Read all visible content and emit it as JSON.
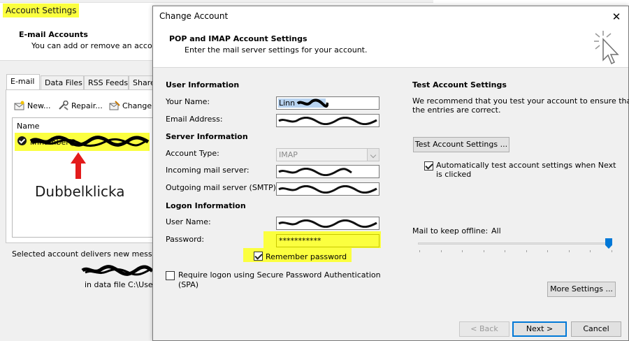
{
  "background_window": {
    "title": "Account Settings",
    "heading": "E-mail Accounts",
    "subheading": "You can add or remove an account",
    "tabs": [
      {
        "label": "E-mail",
        "active": true
      },
      {
        "label": "Data Files",
        "active": false
      },
      {
        "label": "RSS Feeds",
        "active": false
      },
      {
        "label": "Share",
        "active": false
      }
    ],
    "toolbar": {
      "new_label": "New...",
      "repair_label": "Repair...",
      "change_label": "Change..."
    },
    "list_header": "Name",
    "account_entry": "linnamber@",
    "annotation": "Dubbelklicka",
    "delivers_text": "Selected account delivers new messages",
    "data_file_text": "in data file C:\\Users"
  },
  "dialog": {
    "title": "Change Account",
    "heading": "POP and IMAP Account Settings",
    "subheading": "Enter the mail server settings for your account.",
    "sections": {
      "user_info": "User Information",
      "server_info": "Server Information",
      "logon_info": "Logon Information",
      "test_settings": "Test Account Settings"
    },
    "labels": {
      "your_name": "Your Name:",
      "email": "Email Address:",
      "account_type": "Account Type:",
      "incoming": "Incoming mail server:",
      "outgoing": "Outgoing mail server (SMTP):",
      "user_name": "User Name:",
      "password": "Password:"
    },
    "values": {
      "your_name": "Linn",
      "email": "",
      "account_type": "IMAP",
      "incoming": "",
      "outgoing": "",
      "user_name": "",
      "password": "***********"
    },
    "remember_password": {
      "label": "Remember password",
      "checked": true
    },
    "spa": {
      "label": "Require logon using Secure Password Authentication",
      "label2": "(SPA)",
      "checked": false
    },
    "test_description_1": "We recommend that you test your account to ensure that",
    "test_description_2": "the entries are correct.",
    "test_button": "Test Account Settings ...",
    "auto_test": {
      "label": "Automatically test account settings when Next",
      "label2": "is clicked",
      "checked": true
    },
    "offline_label": "Mail to keep offline:",
    "offline_value": "All",
    "more_settings_button": "More Settings ...",
    "back_button": "< Back",
    "next_button": "Next >",
    "cancel_button": "Cancel",
    "close_glyph": "✕"
  },
  "colors": {
    "highlight": "#fbff3f",
    "accent": "#0078d7",
    "annotation_arrow": "#e31b1b",
    "selection": "#b8d3f0"
  }
}
